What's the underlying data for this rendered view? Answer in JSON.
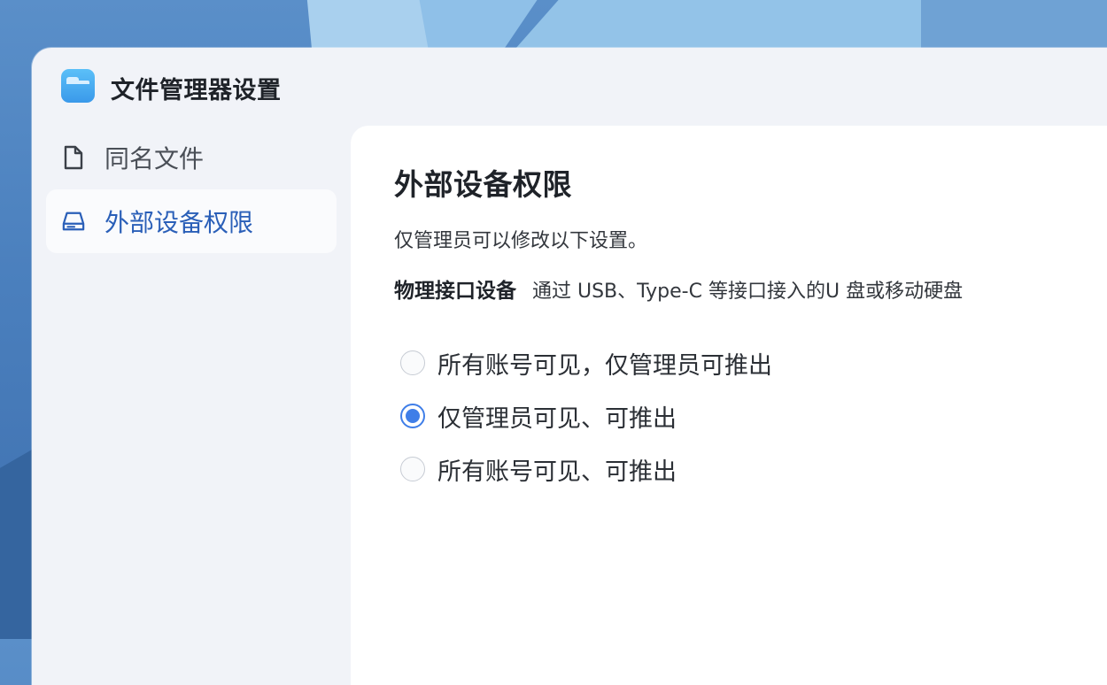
{
  "window": {
    "title": "文件管理器设置",
    "icon": "folder-app-icon"
  },
  "sidebar": {
    "items": [
      {
        "label": "同名文件",
        "icon": "file-icon",
        "active": false
      },
      {
        "label": "外部设备权限",
        "icon": "drive-icon",
        "active": true
      }
    ]
  },
  "main": {
    "title": "外部设备权限",
    "subtitle": "仅管理员可以修改以下设置。",
    "section": {
      "label": "物理接口设备",
      "description": "通过 USB、Type-C 等接口接入的U 盘或移动硬盘"
    },
    "options": [
      {
        "label": "所有账号可见，仅管理员可推出",
        "checked": false
      },
      {
        "label": "仅管理员可见、可推出",
        "checked": true
      },
      {
        "label": "所有账号可见、可推出",
        "checked": false
      }
    ]
  },
  "colors": {
    "accent": "#3f7ee8",
    "active_text": "#2a5fb8",
    "window_bg": "#f1f3f8",
    "content_bg": "#ffffff"
  }
}
